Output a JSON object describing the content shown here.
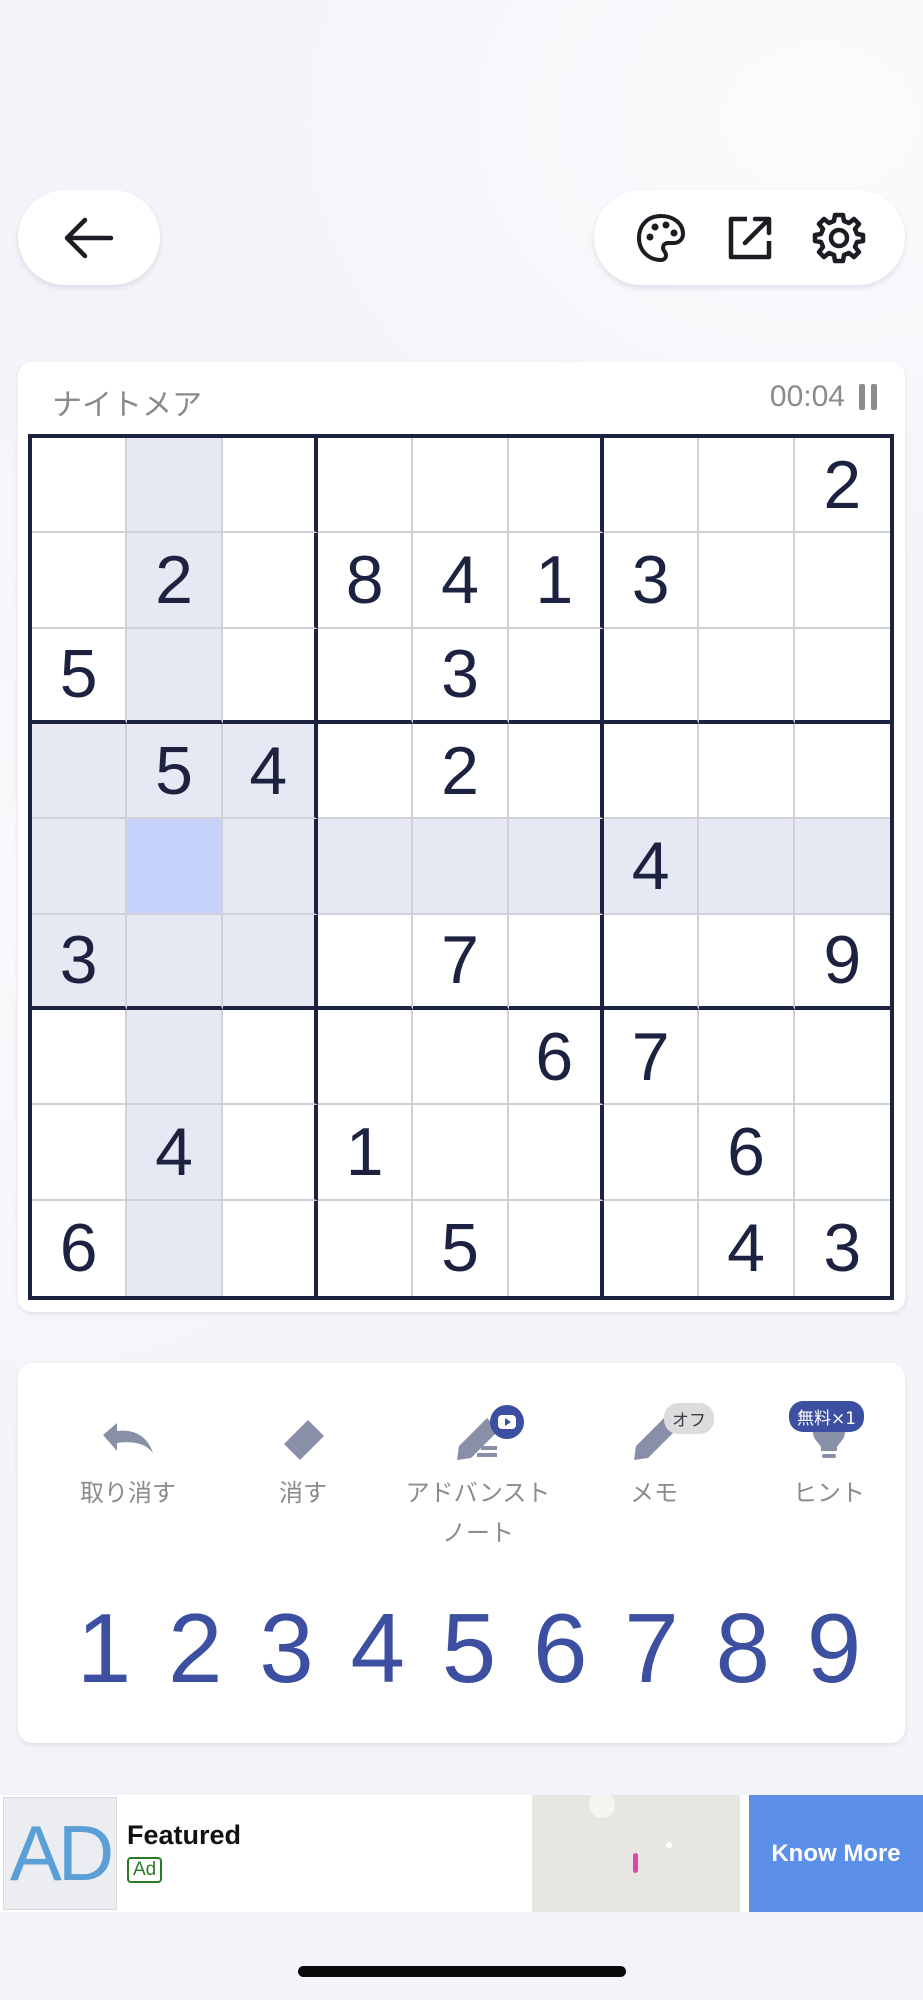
{
  "header": {
    "back_icon": "arrow-left-icon",
    "tools": [
      "palette-icon",
      "share-icon",
      "gear-icon"
    ]
  },
  "game": {
    "difficulty": "ナイトメア",
    "timer": "00:04",
    "selected_cell": {
      "row": 5,
      "col": 2
    },
    "board": [
      [
        "",
        "",
        "",
        "",
        "",
        "",
        "",
        "",
        "2"
      ],
      [
        "",
        "2",
        "",
        "8",
        "4",
        "1",
        "3",
        "",
        ""
      ],
      [
        "5",
        "",
        "",
        "",
        "3",
        "",
        "",
        "",
        ""
      ],
      [
        "",
        "5",
        "4",
        "",
        "2",
        "",
        "",
        "",
        ""
      ],
      [
        "",
        "",
        "",
        "",
        "",
        "",
        "4",
        "",
        ""
      ],
      [
        "3",
        "",
        "",
        "",
        "7",
        "",
        "",
        "",
        "9"
      ],
      [
        "",
        "",
        "",
        "",
        "",
        "6",
        "7",
        "",
        ""
      ],
      [
        "",
        "4",
        "",
        "1",
        "",
        "",
        "",
        "6",
        ""
      ],
      [
        "6",
        "",
        "",
        "",
        "5",
        "",
        "",
        "4",
        "3"
      ]
    ]
  },
  "actions": {
    "undo": "取り消す",
    "erase": "消す",
    "advanced_note": "アドバンスト\nノート",
    "memo": "メモ",
    "memo_state": "オフ",
    "hint": "ヒント",
    "hint_badge": "無料×1"
  },
  "numpad": [
    "1",
    "2",
    "3",
    "4",
    "5",
    "6",
    "7",
    "8",
    "9"
  ],
  "ad": {
    "logo": "AD",
    "title": "Featured",
    "tag": "Ad",
    "cta": "Know More"
  },
  "colors": {
    "accent": "#3d4fa0",
    "grid_line": "#1c2240",
    "highlight": "#e6e8f4",
    "selected": "#c8d3fb"
  }
}
